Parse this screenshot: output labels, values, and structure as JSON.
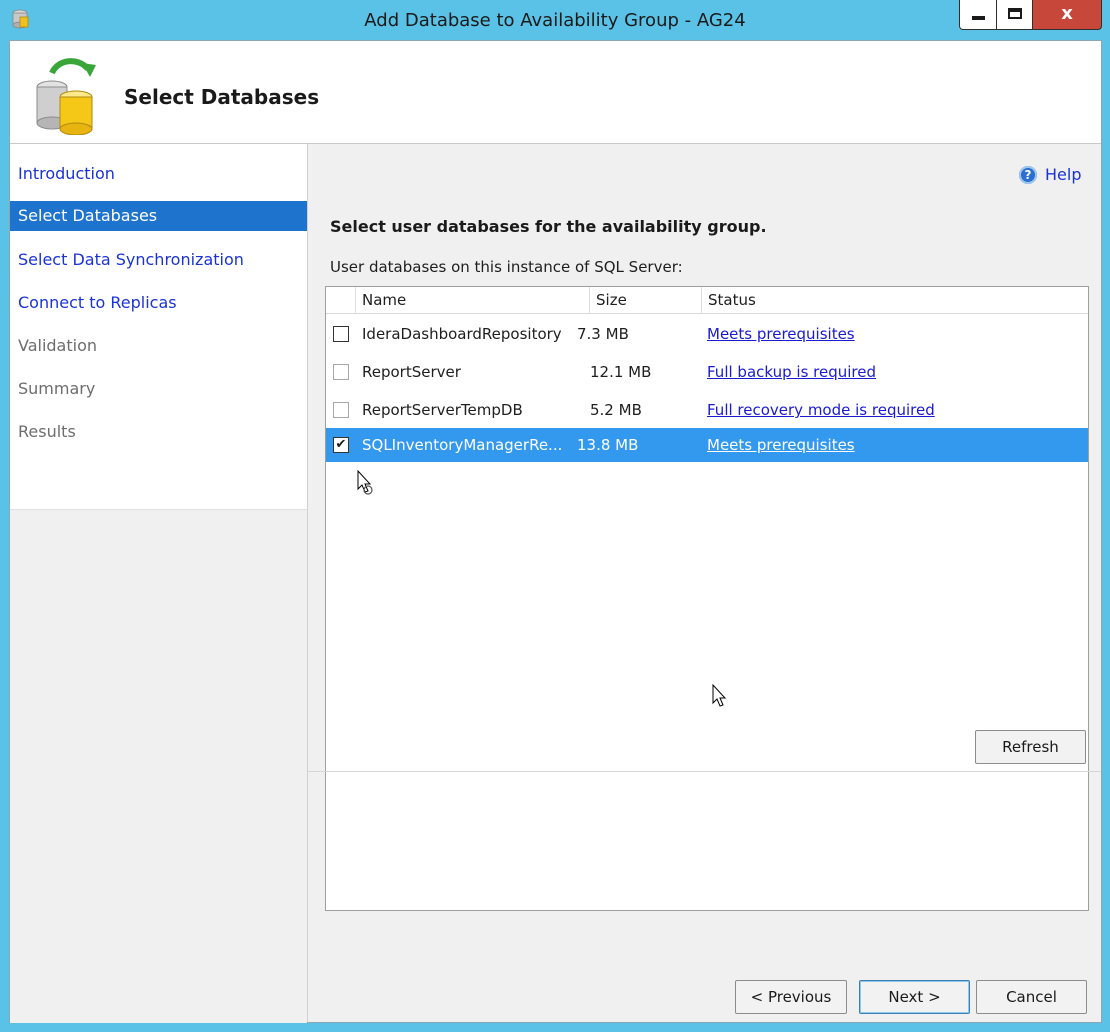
{
  "window": {
    "title": "Add Database to Availability Group - AG24",
    "minimize_glyph": "",
    "maximize_glyph": "",
    "close_glyph": "x"
  },
  "banner": {
    "title": "Select Databases"
  },
  "nav": {
    "items": [
      {
        "label": "Introduction",
        "state": "link"
      },
      {
        "label": "Select Databases",
        "state": "selected"
      },
      {
        "label": "Select Data Synchronization",
        "state": "link"
      },
      {
        "label": "Connect to Replicas",
        "state": "link"
      },
      {
        "label": "Validation",
        "state": "disabled"
      },
      {
        "label": "Summary",
        "state": "disabled"
      },
      {
        "label": "Results",
        "state": "disabled"
      }
    ]
  },
  "help": {
    "label": "Help",
    "icon_glyph": "?"
  },
  "main": {
    "heading": "Select user databases for the availability group.",
    "list_label": "User databases on this instance of SQL Server:"
  },
  "table": {
    "columns": [
      "Name",
      "Size",
      "Status"
    ],
    "rows": [
      {
        "name": "IderaDashboardRepository",
        "size": "7.3 MB",
        "status": "Meets prerequisites",
        "checked": false,
        "enabled": true,
        "check": ""
      },
      {
        "name": "ReportServer",
        "size": "12.1 MB",
        "status": "Full backup is required",
        "checked": false,
        "enabled": false,
        "check": ""
      },
      {
        "name": "ReportServerTempDB",
        "size": "5.2 MB",
        "status": "Full recovery mode is required",
        "checked": false,
        "enabled": false,
        "check": ""
      },
      {
        "name": "SQLInventoryManagerRe...",
        "size": "13.8 MB",
        "status": "Meets prerequisites",
        "checked": true,
        "enabled": true,
        "selected": true,
        "check": "✔"
      }
    ]
  },
  "buttons": {
    "refresh": "Refresh",
    "previous": "< Previous",
    "next": "Next >",
    "cancel": "Cancel"
  },
  "colors": {
    "frame": "#5ac2e6",
    "nav_selected": "#1e73cc",
    "row_selected": "#3399ee",
    "link": "#1a33d6"
  }
}
